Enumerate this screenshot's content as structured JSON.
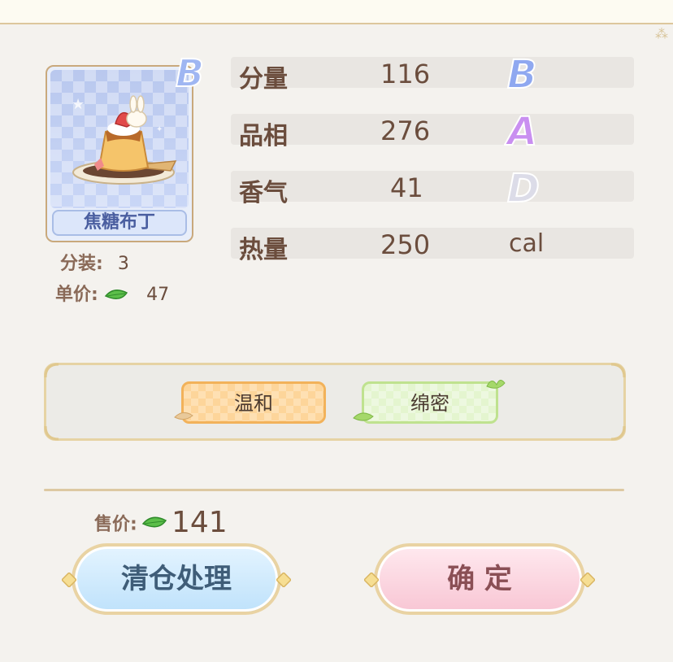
{
  "item": {
    "name": "焦糖布丁",
    "grade": "B",
    "portions_label": "分装:",
    "portions_value": "3",
    "unit_price_label": "单价:",
    "unit_price_value": "47"
  },
  "stats": [
    {
      "label": "分量",
      "value": "116",
      "grade": "B",
      "grade_color": "#8fa8f0"
    },
    {
      "label": "品相",
      "value": "276",
      "grade": "A",
      "grade_color": "#c98ff0"
    },
    {
      "label": "香气",
      "value": "41",
      "grade": "D",
      "grade_color": "#d7d7e4"
    },
    {
      "label": "热量",
      "value": "250",
      "unit": "cal"
    }
  ],
  "tags": [
    {
      "label": "温和",
      "color": "#fdd59a"
    },
    {
      "label": "绵密",
      "color": "#e4f5cf"
    }
  ],
  "sale": {
    "label": "售价:",
    "value": "141"
  },
  "buttons": {
    "clearance": "清仓处理",
    "confirm": "确 定"
  },
  "icons": {
    "currency": "leaf-icon",
    "item_art": "caramel-pudding-icon"
  }
}
